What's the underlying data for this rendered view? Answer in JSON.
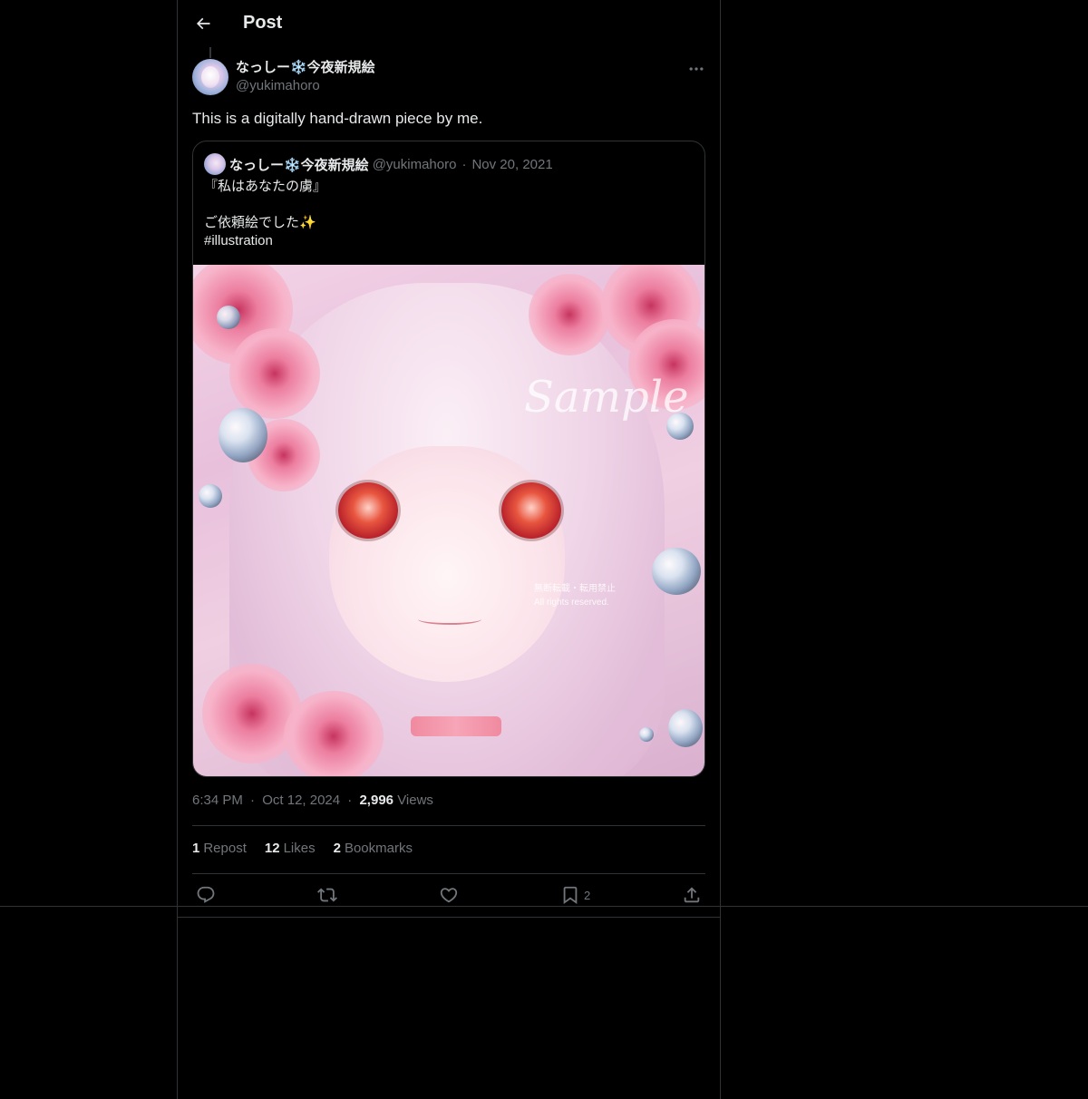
{
  "header": {
    "title": "Post",
    "back_icon": "arrow-left-icon"
  },
  "post": {
    "author_name": "なっしー❄️今夜新規絵",
    "author_handle": "@yukimahoro",
    "text": "This is a digitally hand-drawn piece by me.",
    "time": "6:34 PM",
    "date": "Oct 12, 2024",
    "views_count": "2,996",
    "views_label": "Views",
    "separator": "·"
  },
  "quote": {
    "author_name": "なっしー❄️今夜新規絵",
    "author_handle": "@yukimahoro",
    "separator": "·",
    "date": "Nov 20, 2021",
    "lines": [
      "『私はあなたの虜』",
      "",
      "ご依頼絵でした✨",
      "#illustration"
    ],
    "image": {
      "watermark": "Sample",
      "note_line1": "無断転載・転用禁止",
      "note_line2": "All rights reserved."
    }
  },
  "stats": {
    "reposts_count": "1",
    "reposts_label": "Repost",
    "likes_count": "12",
    "likes_label": "Likes",
    "bookmarks_count": "2",
    "bookmarks_label": "Bookmarks"
  },
  "actions": {
    "reply_icon": "reply-icon",
    "repost_icon": "repost-icon",
    "like_icon": "heart-icon",
    "bookmark_icon": "bookmark-icon",
    "bookmark_count": "2",
    "share_icon": "share-icon"
  },
  "colors": {
    "background": "#000000",
    "text_primary": "#e7e9ea",
    "text_secondary": "#71767b",
    "border": "#2f3336"
  }
}
